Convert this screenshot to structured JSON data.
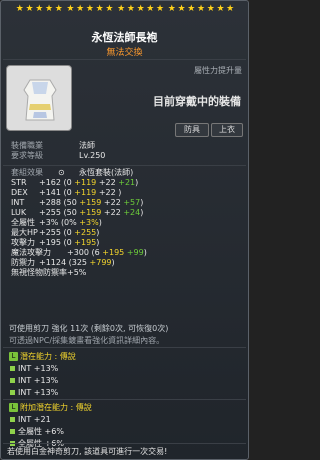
{
  "item": {
    "name": "永恆法師長袍",
    "trade": "無法交換",
    "compare_label": "屬性力提升量",
    "equipped_text": "目前穿戴中的裝備",
    "chip_category": "防具",
    "chip_slot": "上衣",
    "stars_total": 22
  },
  "requirements": {
    "job_label": "裝備職業",
    "job_value": "法師",
    "level_label": "要求等級",
    "level_value": "Lv.250"
  },
  "set": {
    "label": "套組效果",
    "name": "永恆套裝(法師)"
  },
  "stats": [
    {
      "label": "STR",
      "base": "+162",
      "open": "(0 ",
      "a": "+119",
      "b": "+22",
      "c": "+21",
      "close": ")"
    },
    {
      "label": "DEX",
      "base": "+141",
      "open": "(0 ",
      "a": "+119",
      "b": "+22",
      "c": "",
      "close": ")"
    },
    {
      "label": "INT",
      "base": "+288",
      "open": "(50 ",
      "a": "+159",
      "b": "+22",
      "c": "+57",
      "close": ")"
    },
    {
      "label": "LUK",
      "base": "+255",
      "open": "(50 ",
      "a": "+159",
      "b": "+22",
      "c": "+24",
      "close": ")"
    }
  ],
  "extra_stats": [
    {
      "label": "全屬性",
      "text": "+3%  (0%  ",
      "y": "+3%",
      "tail": ")"
    },
    {
      "label": "最大HP",
      "text": "+255  (0 ",
      "y": "+255",
      "tail": ")"
    },
    {
      "label": "攻擊力",
      "text": "+195  (0 ",
      "y": "+195",
      "tail": ")"
    },
    {
      "label": "魔法攻擊力",
      "text": "+300  (6 ",
      "y": "+195",
      "g": "+99",
      "tail": ")"
    },
    {
      "label": "防禦力",
      "text": "+1124  (325 ",
      "y": "+799",
      "tail": ")"
    },
    {
      "label": "無視怪物防禦率",
      "text": "+5%",
      "y": "",
      "tail": ""
    }
  ],
  "enhance": {
    "line1": "可使用剪刀 強化 11次 (剩餘0次, 可恢復0次)",
    "line2": "可透過NPC/採集鍍畫看強化資訊詳細內容。"
  },
  "potential": {
    "title": "潛在能力 : 傳說",
    "lines": [
      "INT +13%",
      "INT +13%",
      "INT +13%"
    ]
  },
  "additional": {
    "title": "附加潛在能力 : 傳說",
    "lines": [
      "INT +21",
      "全屬性 +6%",
      "全屬性 +6%"
    ]
  },
  "footer": "若使用白金神奇剪刀, 該道具可進行一次交易!"
}
